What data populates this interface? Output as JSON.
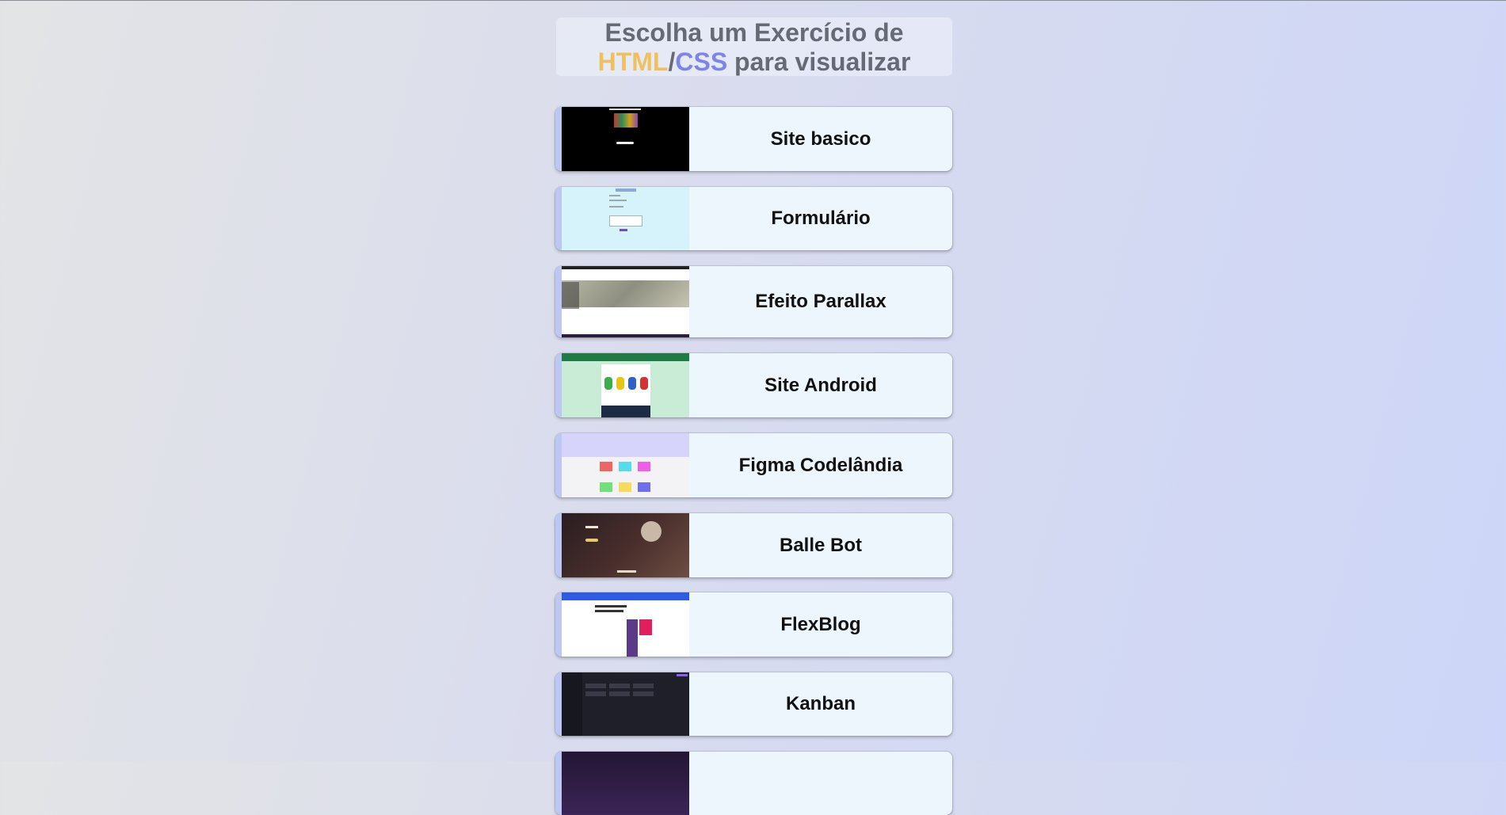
{
  "header": {
    "line1": "Escolha um Exercício de",
    "html_word": "HTML",
    "slash": "/",
    "css_word": "CSS",
    "line2_rest": " para visualizar"
  },
  "colors": {
    "html_accent": "#efc15c",
    "css_accent": "#7d84ec",
    "card_bg": "#eef6fd"
  },
  "exercises": [
    {
      "label": "Site basico"
    },
    {
      "label": "Formulário"
    },
    {
      "label": "Efeito Parallax"
    },
    {
      "label": "Site Android"
    },
    {
      "label": "Figma Codelândia"
    },
    {
      "label": "Balle Bot"
    },
    {
      "label": "FlexBlog"
    },
    {
      "label": "Kanban"
    },
    {
      "label": ""
    }
  ]
}
